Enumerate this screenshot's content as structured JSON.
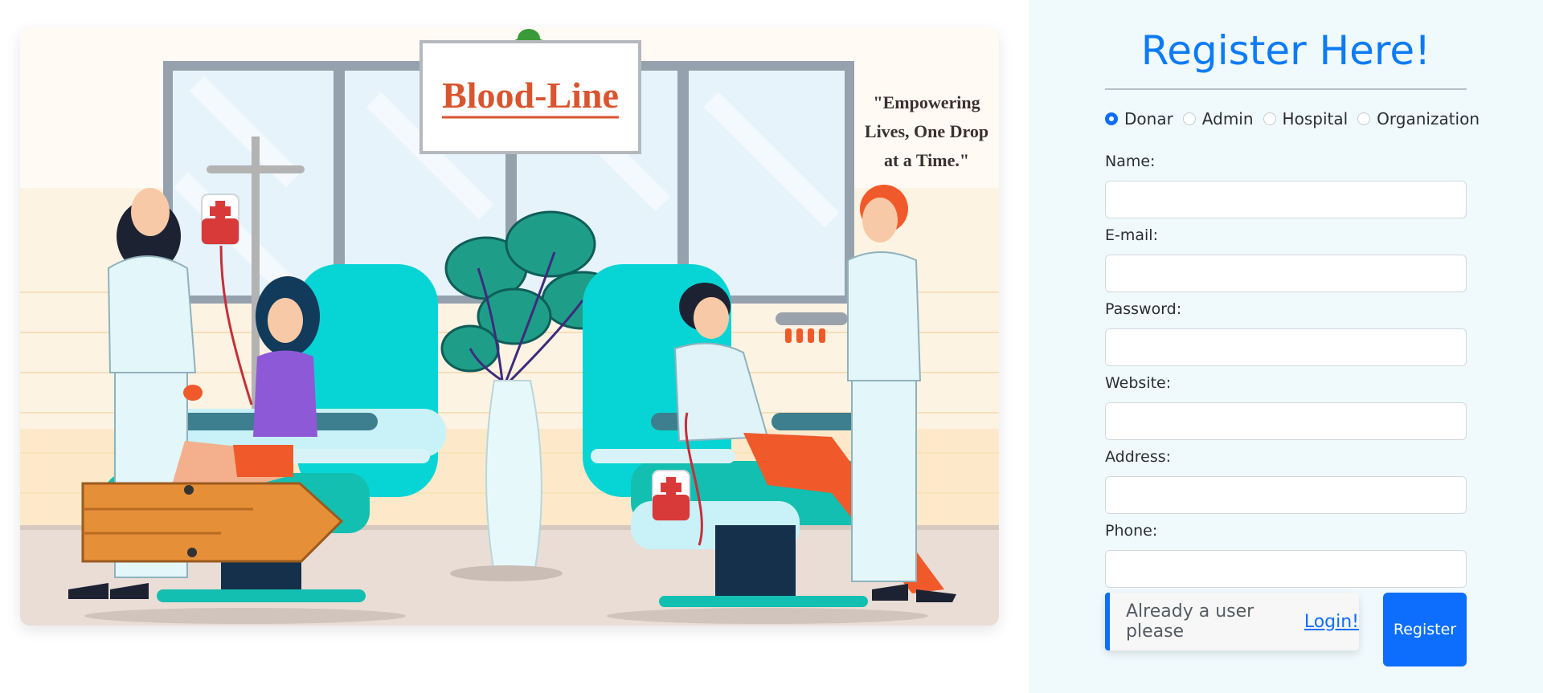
{
  "hero": {
    "sign_text": "Blood-Line",
    "quote_lines": [
      "\"Empowering",
      "Lives, One Drop",
      "at a Time.\""
    ]
  },
  "form": {
    "title": "Register Here!",
    "roles": [
      {
        "label": "Donar",
        "checked": true
      },
      {
        "label": "Admin",
        "checked": false
      },
      {
        "label": "Hospital",
        "checked": false
      },
      {
        "label": "Organization",
        "checked": false
      }
    ],
    "fields": [
      {
        "label": "Name:",
        "value": ""
      },
      {
        "label": "E-mail:",
        "value": ""
      },
      {
        "label": "Password:",
        "value": ""
      },
      {
        "label": "Website:",
        "value": ""
      },
      {
        "label": "Address:",
        "value": ""
      },
      {
        "label": "Phone:",
        "value": ""
      }
    ],
    "login_prompt": "Already a user please",
    "login_link": "Login!",
    "register_label": "Register"
  },
  "colors": {
    "accent": "#0d6efd",
    "title": "#0d7bf5",
    "panel_bg": "#f0fafd"
  }
}
